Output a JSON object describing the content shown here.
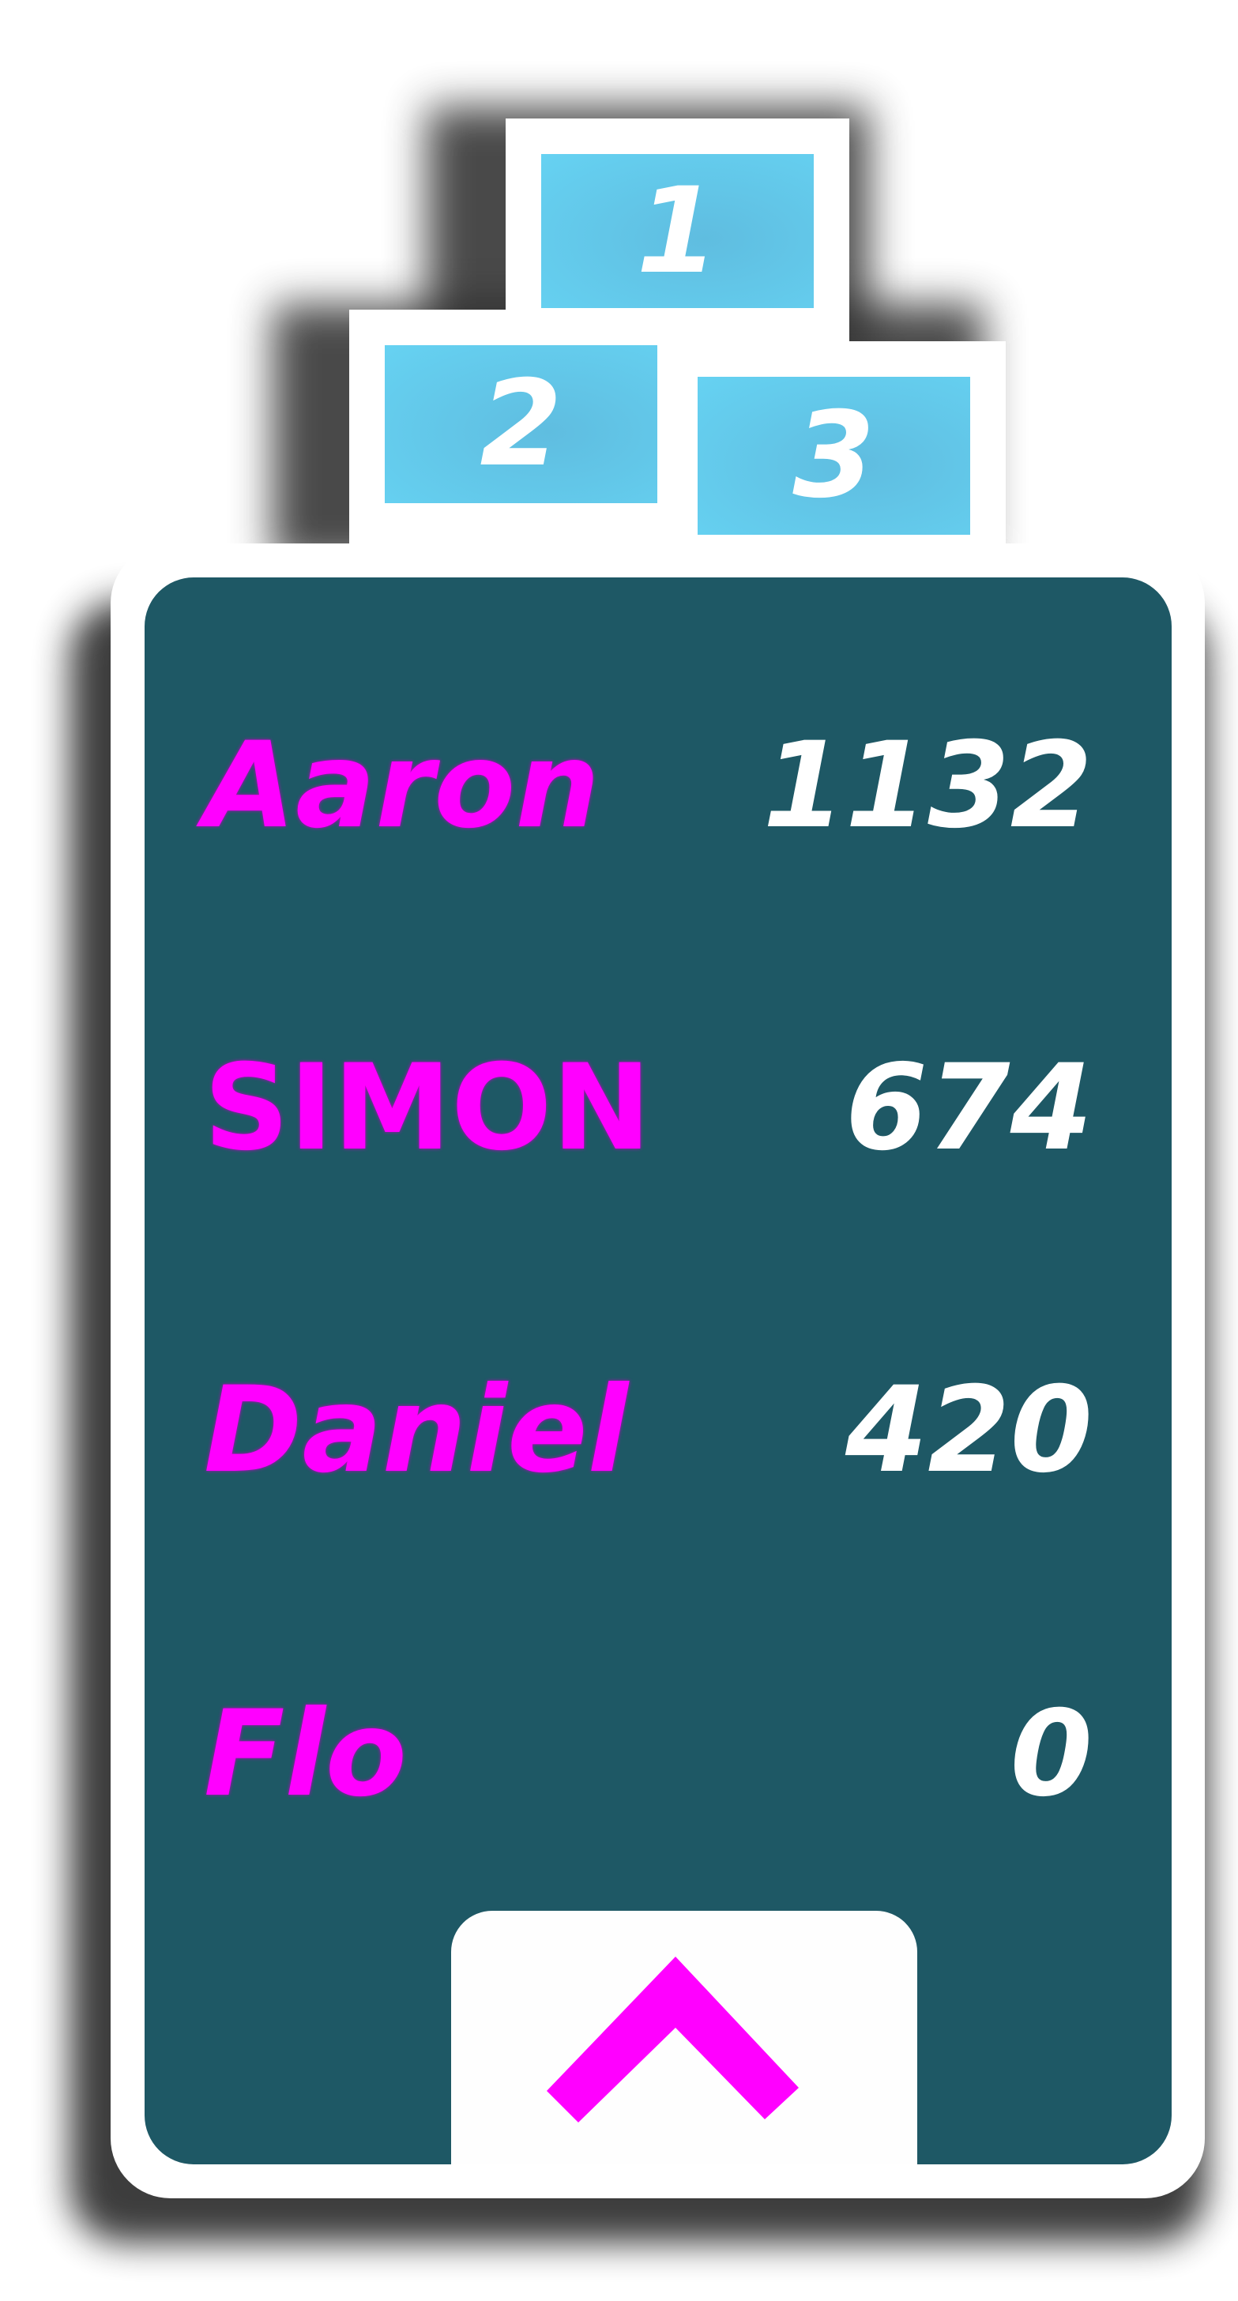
{
  "podium": {
    "places": [
      {
        "rank": "1"
      },
      {
        "rank": "2"
      },
      {
        "rank": "3"
      }
    ],
    "color": "#66d2f2"
  },
  "leaderboard": {
    "rows": [
      {
        "name": "Aaron",
        "score": "1132"
      },
      {
        "name": "SIMON",
        "score": "674"
      },
      {
        "name": "Daniel",
        "score": "420"
      },
      {
        "name": "Flo",
        "score": "0"
      }
    ],
    "name_color": "#ff00ff",
    "score_color": "#ffffff",
    "background_color": "#1e5865"
  },
  "controls": {
    "up_button_icon": "chevron-up-icon",
    "icon_color": "#ff00ff"
  }
}
